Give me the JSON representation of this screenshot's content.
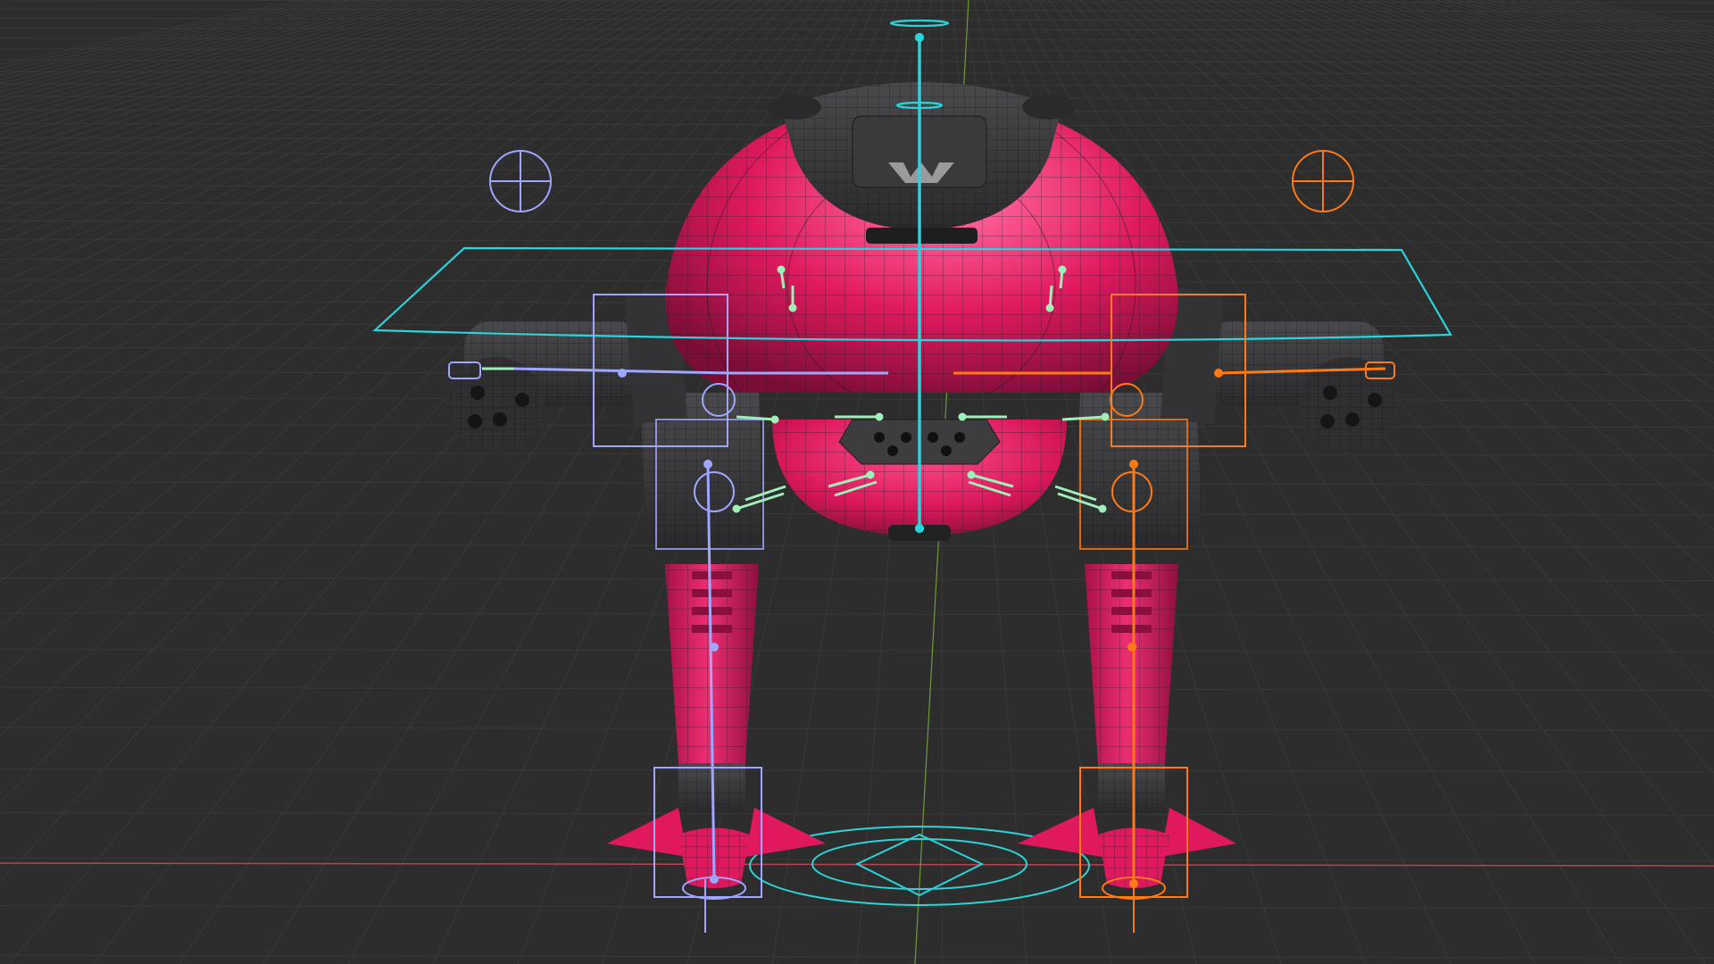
{
  "viewport": {
    "background": "#2d2d2d",
    "grid_color": "#393939",
    "axis_x_color": "#b4464e",
    "axis_y_color": "#6e9a3c"
  },
  "model": {
    "body_color": "#e0195f",
    "body_dark_color": "#8a0f3e",
    "armor_color": "#3c3c3f",
    "armor_dark_color": "#232325",
    "wire_color": "#1c1c1c"
  },
  "rig": {
    "center_color": "#2ad4d8",
    "left_color": "#9fa6ff",
    "right_color": "#ff7a14",
    "helper_color": "#9ff0b8"
  },
  "icons": [
    "ik-target-left-icon",
    "ik-target-right-icon",
    "root-control-icon"
  ]
}
